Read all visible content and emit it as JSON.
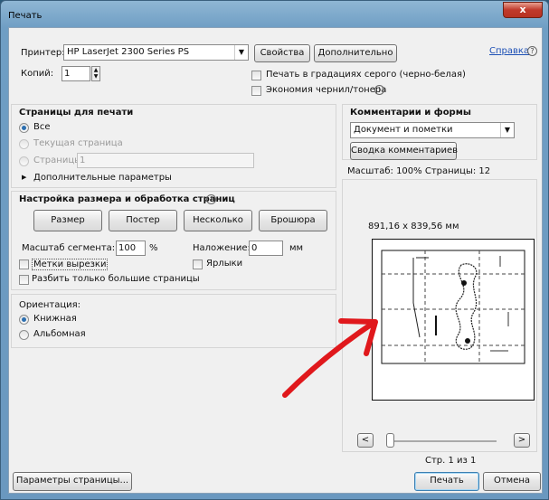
{
  "window": {
    "title": "Печать",
    "close_label": "x"
  },
  "printer": {
    "label": "Принтер:",
    "value": "HP LaserJet 2300 Series PS",
    "properties_button": "Свойства",
    "advanced_button": "Дополнительно",
    "help_link": "Справка"
  },
  "copies": {
    "label": "Копий:",
    "value": "1"
  },
  "options": {
    "grayscale": "Печать в градациях серого (черно-белая)",
    "save_ink": "Экономия чернил/тонера"
  },
  "pages_panel": {
    "title": "Страницы для печати",
    "all": "Все",
    "current": "Текущая страница",
    "pages_label": "Страницы",
    "pages_value": "1",
    "more_options": "Дополнительные параметры"
  },
  "comments_panel": {
    "title": "Комментарии и формы",
    "select_value": "Документ и пометки",
    "summarize_button": "Сводка комментариев"
  },
  "sizing_panel": {
    "title": "Настройка размера и обработка страниц",
    "tabs": [
      "Размер",
      "Постер",
      "Несколько",
      "Брошюра"
    ],
    "tile_scale_label": "Масштаб сегмента:",
    "tile_scale_value": "100",
    "tile_scale_unit": "%",
    "overlap_label": "Наложение:",
    "overlap_value": "0",
    "overlap_unit": "мм",
    "cut_marks": "Метки вырезки",
    "labels": "Ярлыки",
    "tile_large_only": "Разбить только большие страницы"
  },
  "orientation": {
    "title": "Ориентация:",
    "portrait": "Книжная",
    "landscape": "Альбомная"
  },
  "preview": {
    "scale_text": "Масштаб: 100% Страницы: 12",
    "dimensions": "891,16 x 839,56 мм",
    "prev_button": "<",
    "next_button": ">",
    "page_indicator": "Стр. 1 из 1"
  },
  "footer": {
    "page_setup_button": "Параметры страницы...",
    "print_button": "Печать",
    "cancel_button": "Отмена"
  },
  "colors": {
    "accent_radio": "#2c6fb0",
    "link": "#1c4fb5",
    "annotation_arrow": "#e0181c",
    "close_button": "#c0392b"
  }
}
